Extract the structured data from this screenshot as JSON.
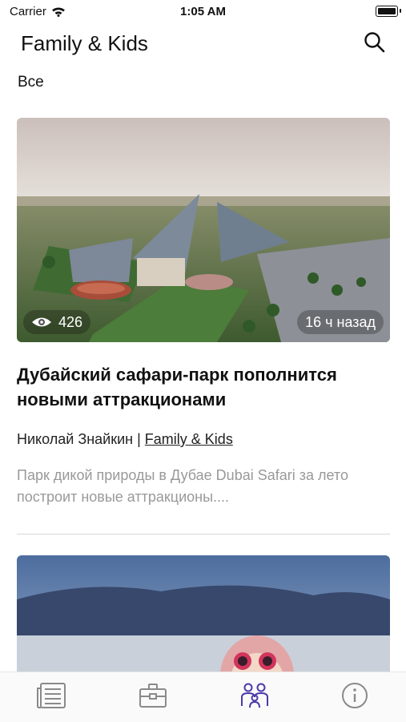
{
  "status": {
    "carrier": "Carrier",
    "time": "1:05 AM"
  },
  "nav": {
    "title": "Family & Kids",
    "search_icon": "search-icon"
  },
  "category": {
    "label": "Все"
  },
  "article": {
    "views": "426",
    "time_ago": "16 ч назад",
    "title": "Дубайский сафари-парк пополнится новыми аттракционами",
    "author": "Николай Знайкин",
    "separator": "|",
    "section": "Family & Kids",
    "excerpt": "Парк дикой природы в Дубае Dubai Safari за лето построит новые аттракционы...."
  },
  "tabbar": {
    "items": [
      {
        "icon": "newspaper-icon",
        "active": false
      },
      {
        "icon": "briefcase-icon",
        "active": false
      },
      {
        "icon": "family-icon",
        "active": true
      },
      {
        "icon": "info-icon",
        "active": false
      }
    ],
    "active_color": "#4a3aa8",
    "inactive_color": "#8a8a8a"
  }
}
